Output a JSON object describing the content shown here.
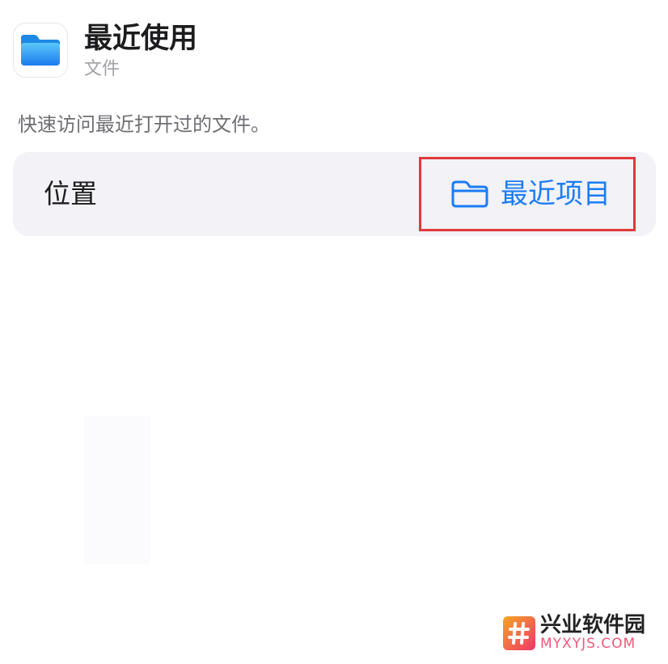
{
  "header": {
    "app_icon": "folder-icon",
    "title": "最近使用",
    "subtitle": "文件"
  },
  "description": "快速访问最近打开过的文件。",
  "parameter": {
    "label": "位置",
    "value_icon": "folder-outline-icon",
    "value": "最近项目"
  },
  "watermark": {
    "name": "兴业软件园",
    "url": "MYXYJS.COM"
  },
  "colors": {
    "accent": "#1b7cf5",
    "highlight_border": "#e0393e",
    "row_background": "#f2f2f7",
    "folder_blue": "#2e9bf5"
  }
}
